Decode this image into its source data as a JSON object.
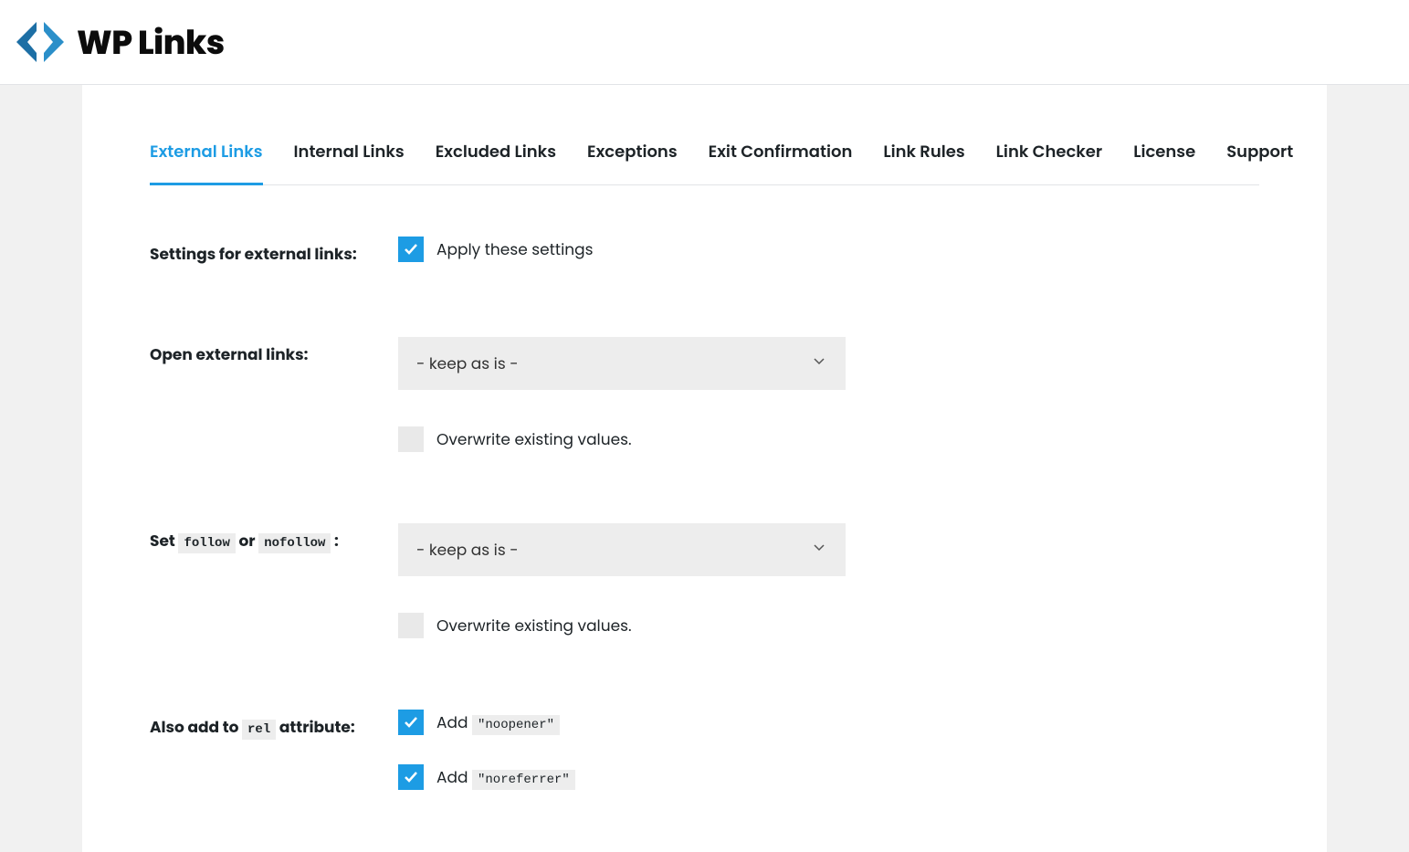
{
  "brand": {
    "name": "WP Links"
  },
  "tabs": [
    {
      "label": "External Links",
      "active": true
    },
    {
      "label": "Internal Links",
      "active": false
    },
    {
      "label": "Excluded Links",
      "active": false
    },
    {
      "label": "Exceptions",
      "active": false
    },
    {
      "label": "Exit Confirmation",
      "active": false
    },
    {
      "label": "Link Rules",
      "active": false
    },
    {
      "label": "Link Checker",
      "active": false
    },
    {
      "label": "License",
      "active": false
    },
    {
      "label": "Support",
      "active": false
    }
  ],
  "form": {
    "settings_label": "Settings for external links:",
    "apply_label": "Apply these settings",
    "open_label": "Open external links:",
    "open_value": "- keep as is -",
    "overwrite_label": "Overwrite existing values.",
    "follow_label_prefix": "Set ",
    "follow_code1": "follow",
    "follow_label_mid": " or ",
    "follow_code2": "nofollow",
    "follow_label_suffix": " :",
    "follow_value": "- keep as is -",
    "rel_label_prefix": "Also add to ",
    "rel_code": "rel",
    "rel_label_suffix": " attribute:",
    "noopener_prefix": "Add ",
    "noopener_code": "\"noopener\"",
    "noreferrer_prefix": "Add ",
    "noreferrer_code": "\"noreferrer\""
  }
}
